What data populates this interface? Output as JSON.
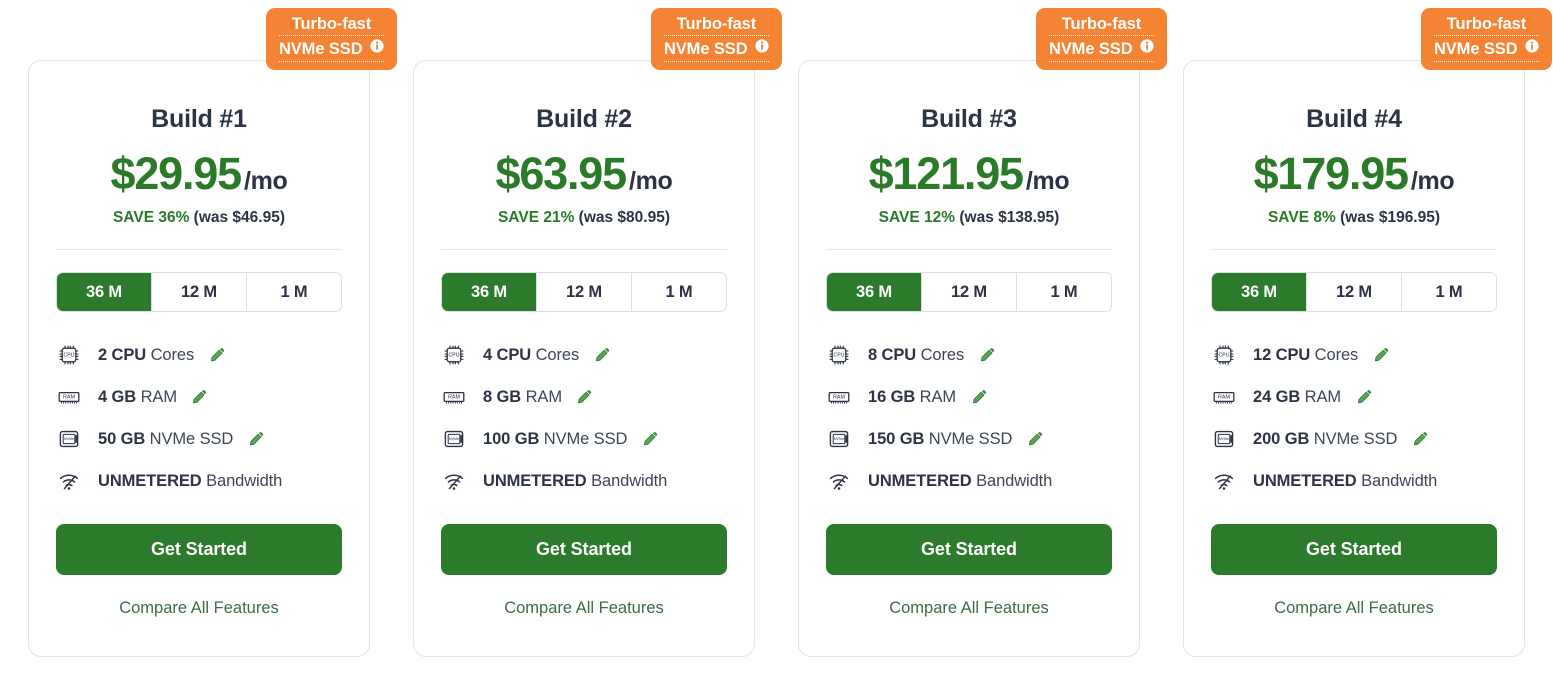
{
  "badge": {
    "line1": "Turbo-fast",
    "line2": "NVMe SSD",
    "info_icon": "info-circle-icon",
    "color": "#f58334"
  },
  "colors": {
    "price_green": "#2a7a2a",
    "cta_green": "#2c7a2c",
    "title_navy": "#2c3345",
    "badge_orange": "#f58334",
    "link_green": "#3d6b47",
    "card_border": "#e2e4e6"
  },
  "labels": {
    "period": "/mo",
    "cta": "Get Started",
    "compare": "Compare All Features",
    "cores_suffix": "Cores",
    "ram_suffix": "RAM",
    "ssd_suffix": "NVMe SSD",
    "bandwidth_suffix": "Bandwidth",
    "edit_icon": "pencil-edit-icon",
    "cpu_icon": "cpu-chip-icon",
    "ram_icon": "ram-module-icon",
    "ssd_icon": "nvme-drive-icon",
    "bandwidth_icon": "wifi-unmetered-icon"
  },
  "terms": [
    "36 M",
    "12 M",
    "1 M"
  ],
  "plans": [
    {
      "title": "Build #1",
      "price": "$29.95",
      "save_pct": "SAVE 36%",
      "was": "(was $46.95)",
      "active_term": "36 M",
      "cpu": "2 CPU",
      "ram": "4 GB",
      "ssd": "50 GB",
      "bandwidth": "UNMETERED"
    },
    {
      "title": "Build #2",
      "price": "$63.95",
      "save_pct": "SAVE 21%",
      "was": "(was $80.95)",
      "active_term": "36 M",
      "cpu": "4 CPU",
      "ram": "8 GB",
      "ssd": "100 GB",
      "bandwidth": "UNMETERED"
    },
    {
      "title": "Build #3",
      "price": "$121.95",
      "save_pct": "SAVE 12%",
      "was": "(was $138.95)",
      "active_term": "36 M",
      "cpu": "8 CPU",
      "ram": "16 GB",
      "ssd": "150 GB",
      "bandwidth": "UNMETERED"
    },
    {
      "title": "Build #4",
      "price": "$179.95",
      "save_pct": "SAVE 8%",
      "was": "(was $196.95)",
      "active_term": "36 M",
      "cpu": "12 CPU",
      "ram": "24 GB",
      "ssd": "200 GB",
      "bandwidth": "UNMETERED"
    }
  ]
}
